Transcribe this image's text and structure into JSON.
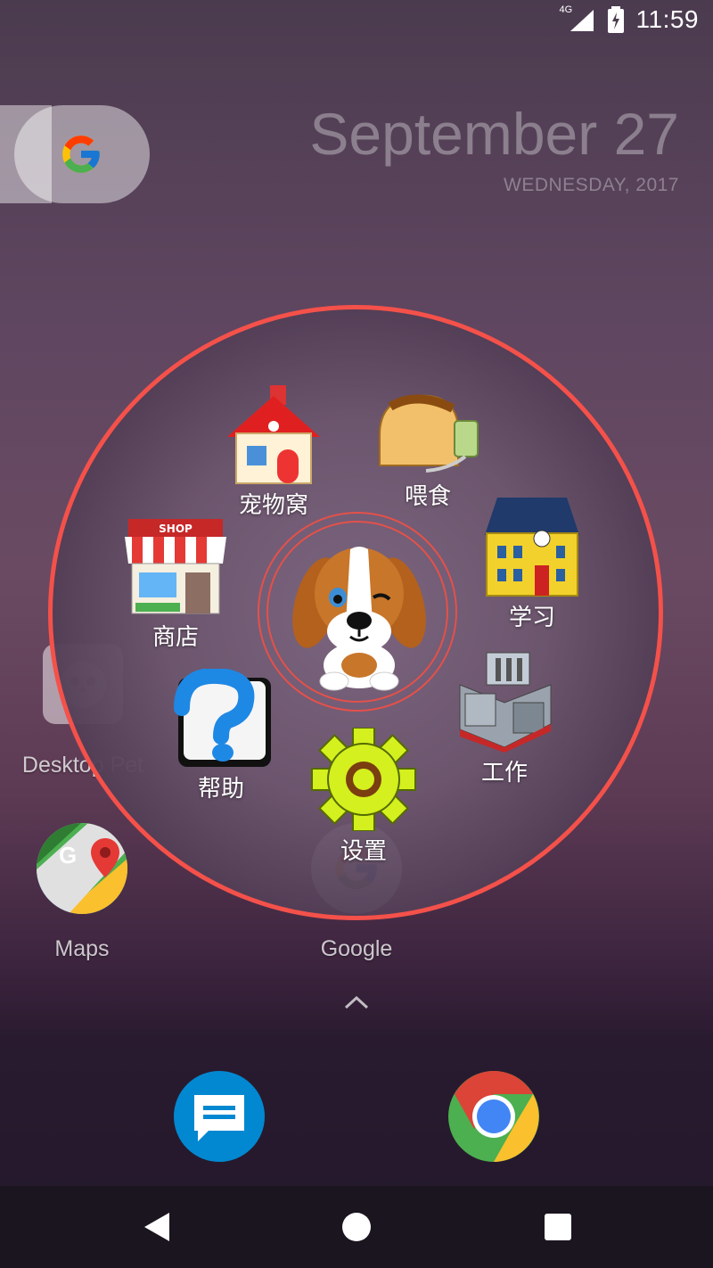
{
  "status_bar": {
    "network_label": "4G",
    "time": "11:59",
    "icons": [
      "signal-icon",
      "battery-charging-icon"
    ]
  },
  "google_widget": {
    "icon": "google-g-icon"
  },
  "date_widget": {
    "main": "September 27",
    "sub": "WEDNESDAY, 2017"
  },
  "home_apps": [
    {
      "label": "Desktop Pet",
      "icon": "desktop-pet-icon"
    },
    {
      "label": "Maps",
      "icon": "maps-icon"
    },
    {
      "label": "Google",
      "icon": "google-icon"
    }
  ],
  "pet_menu": {
    "ring_color": "#f4514a",
    "center_icon": "puppy-icon",
    "items": [
      {
        "label": "宠物窝",
        "icon": "pet-house-icon"
      },
      {
        "label": "喂食",
        "icon": "food-bread-icon"
      },
      {
        "label": "学习",
        "icon": "school-building-icon"
      },
      {
        "label": "商店",
        "icon": "shop-icon"
      },
      {
        "label": "工作",
        "icon": "factory-icon"
      },
      {
        "label": "帮助",
        "icon": "help-question-icon"
      },
      {
        "label": "设置",
        "icon": "settings-gear-icon"
      }
    ]
  },
  "dock": {
    "apps": [
      {
        "icon": "messages-icon"
      },
      {
        "icon": "chrome-icon"
      }
    ]
  },
  "nav_bar": {
    "buttons": [
      "back-icon",
      "home-icon",
      "recents-icon"
    ]
  }
}
